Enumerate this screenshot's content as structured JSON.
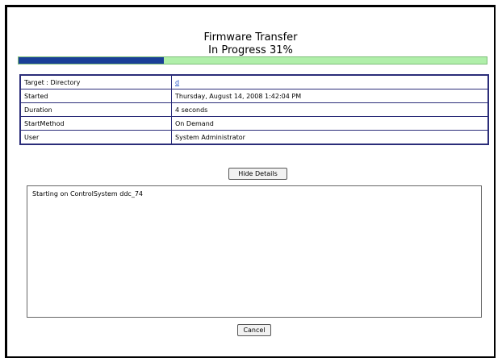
{
  "dialog": {
    "title": "Firmware Transfer",
    "status": "In Progress 31%",
    "progress_percent": 31
  },
  "details": [
    {
      "label": "Target : Directory",
      "value": "d",
      "is_link": true
    },
    {
      "label": "Started",
      "value": "Thursday, August 14, 2008 1:42:04 PM"
    },
    {
      "label": "Duration",
      "value": "4 seconds"
    },
    {
      "label": "StartMethod",
      "value": "On Demand"
    },
    {
      "label": "User",
      "value": "System Administrator"
    }
  ],
  "buttons": {
    "hide_details": "Hide Details",
    "cancel": "Cancel"
  },
  "log": {
    "text": "Starting on ControlSystem ddc_74"
  },
  "colors": {
    "progress_fill": "#1a3f97",
    "progress_track": "#b0efaa",
    "table_border": "#2b2d79"
  }
}
